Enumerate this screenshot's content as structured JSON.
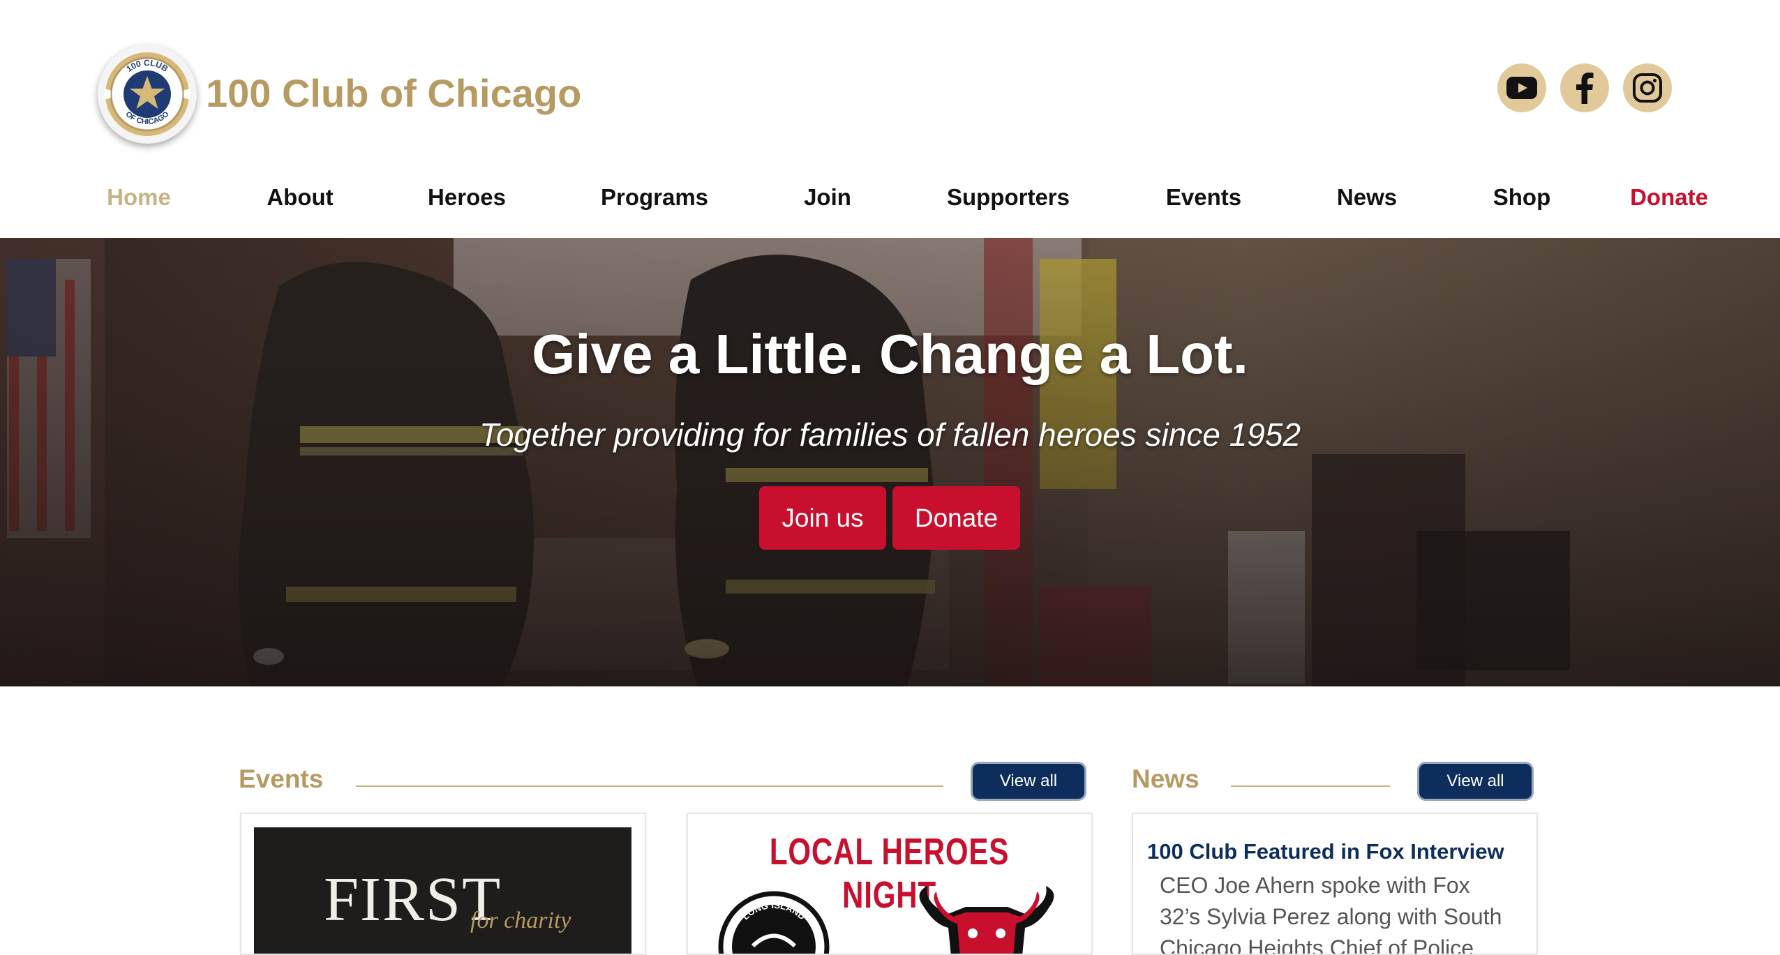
{
  "site": {
    "name": "100 Club of Chicago",
    "seal_text_top": "100 CLUB",
    "seal_text_bottom": "OF CHICAGO"
  },
  "social": [
    {
      "icon": "youtube-icon"
    },
    {
      "icon": "facebook-icon"
    },
    {
      "icon": "instagram-icon"
    }
  ],
  "nav": {
    "items": [
      "Home",
      "About",
      "Heroes",
      "Programs",
      "Join",
      "Supporters",
      "Events",
      "News",
      "Shop",
      "Donate"
    ],
    "active": "Home"
  },
  "hero": {
    "title": "Give a Little. Change a Lot.",
    "subtitle": "Together providing for families of fallen heroes since 1952",
    "join_label": "Join us",
    "donate_label": "Donate"
  },
  "events": {
    "title": "Events",
    "view_all": "View all",
    "cards": [
      {
        "line1": "FIRST",
        "script": "for charity"
      },
      {
        "banner": "LOCAL HEROES NIGHT",
        "badge_left": "LONG ISLAND"
      }
    ]
  },
  "news": {
    "title": "News",
    "view_all": "View all",
    "headline": "100 Club Featured in Fox Interview",
    "body": "CEO Joe Ahern spoke with Fox 32’s Sylvia Perez along with South Chicago Heights Chief of Police"
  },
  "colors": {
    "gold": "#b79a62",
    "red": "#c8102e",
    "navy": "#0d2d5c",
    "social_bg": "#e2c99a"
  }
}
